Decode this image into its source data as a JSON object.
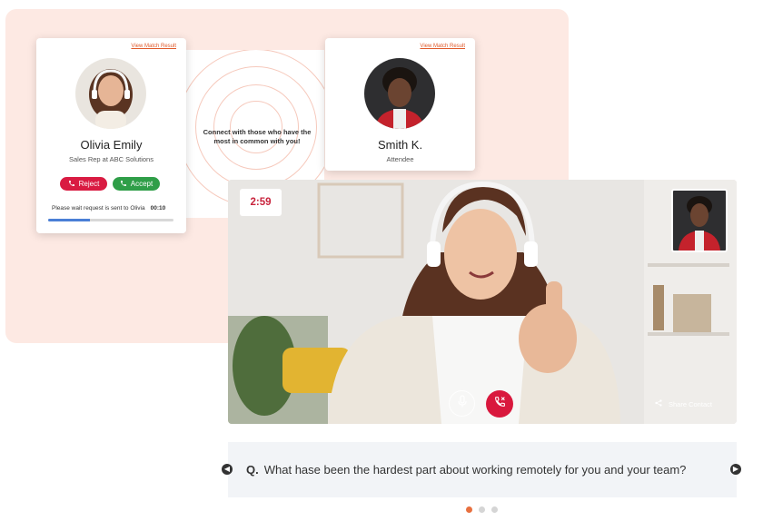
{
  "match": {
    "connect_text": "Connect with those who have the most in common with you!",
    "left_card": {
      "link": "View Match Result",
      "name": "Olivia Emily",
      "role": "Sales Rep at ABC Solutions",
      "reject_label": "Reject",
      "accept_label": "Accept",
      "wait_text": "Please wait request is sent to Olivia",
      "wait_timer": "00:10",
      "progress_fraction": 0.33
    },
    "right_card": {
      "link": "View Match Result",
      "name": "Smith K.",
      "role": "Attendee"
    }
  },
  "video_call": {
    "timer": "2:59",
    "share_label": "Share Contact"
  },
  "question": {
    "prefix": "Q.",
    "text": "What hase been the hardest part about  working remotely  for you and your team?"
  },
  "carousel": {
    "dot_count": 3,
    "active_index": 0
  },
  "colors": {
    "accent": "#e8703f",
    "reject": "#d91b42",
    "accept": "#2f9e48",
    "end_call": "#d9183d",
    "panel_bg": "#fde9e3"
  },
  "icons": [
    "phone-reject-icon",
    "phone-accept-icon",
    "mic-icon",
    "end-call-icon",
    "share-icon",
    "chevron-left-icon",
    "chevron-right-icon"
  ]
}
